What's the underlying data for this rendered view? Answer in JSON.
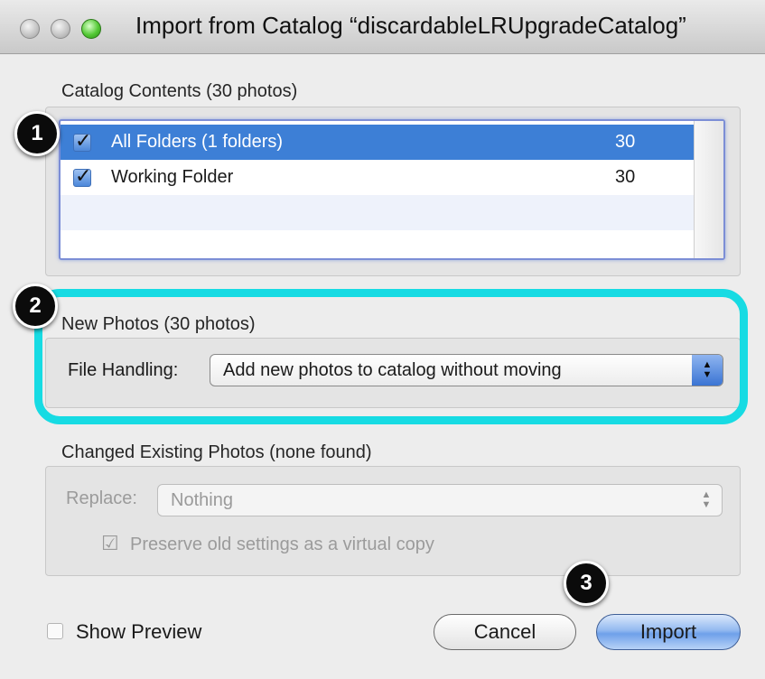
{
  "window": {
    "title": "Import from Catalog “discardableLRUpgradeCatalog”"
  },
  "catalog_contents": {
    "label": "Catalog Contents (30 photos)",
    "rows": [
      {
        "name": "All Folders (1 folders)",
        "count": "30",
        "checked": true,
        "selected": true
      },
      {
        "name": "Working Folder",
        "count": "30",
        "checked": true,
        "selected": false
      }
    ]
  },
  "new_photos": {
    "label": "New Photos (30 photos)",
    "file_handling_label": "File Handling:",
    "file_handling_value": "Add new photos to catalog without moving"
  },
  "changed_photos": {
    "label": "Changed Existing Photos (none found)",
    "replace_label": "Replace:",
    "replace_value": "Nothing",
    "preserve_label": "Preserve old settings as a virtual copy"
  },
  "footer": {
    "show_preview_label": "Show Preview",
    "cancel_label": "Cancel",
    "import_label": "Import"
  },
  "badges": {
    "one": "1",
    "two": "2",
    "three": "3"
  },
  "colors": {
    "highlight": "#17dbe3",
    "selection": "#3d7fd6"
  }
}
